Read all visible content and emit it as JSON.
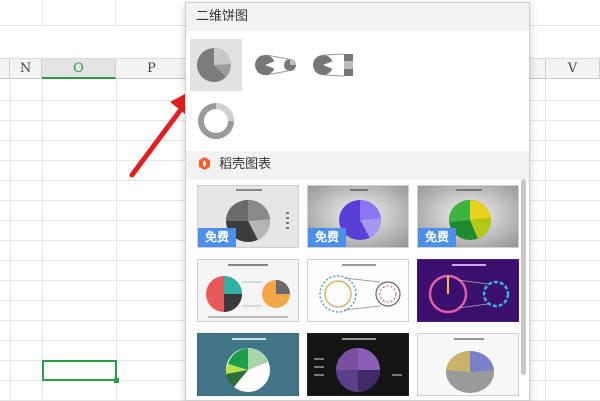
{
  "spreadsheet": {
    "columns": [
      {
        "label": "",
        "active": false
      },
      {
        "label": "N",
        "active": false
      },
      {
        "label": "O",
        "active": true
      },
      {
        "label": "P",
        "active": false
      },
      {
        "label": "V",
        "active": false
      }
    ]
  },
  "popup": {
    "section_2d_pie": "二维饼图",
    "section_wuke": "稻壳图表",
    "chart_types": [
      {
        "name": "pie",
        "selected": true
      },
      {
        "name": "pie-of-pie",
        "selected": false
      },
      {
        "name": "bar-of-pie",
        "selected": false
      },
      {
        "name": "doughnut",
        "selected": false
      }
    ],
    "free_label": "免费",
    "templates": [
      {
        "name": "gray-3d-pie",
        "free": true
      },
      {
        "name": "purple-3d-pie",
        "free": true
      },
      {
        "name": "green-yellow-3d-pie",
        "free": true
      },
      {
        "name": "multi-color-pie-of-pie",
        "free": false
      },
      {
        "name": "dashed-ring-pie-of-pie",
        "free": false
      },
      {
        "name": "purple-bg-pie-of-pie",
        "free": false
      },
      {
        "name": "teal-bg-pie",
        "free": false
      },
      {
        "name": "dark-bg-purple-pie",
        "free": false
      },
      {
        "name": "light-3d-pie",
        "free": false
      }
    ]
  },
  "colors": {
    "accent_green": "#2a9d45",
    "free_badge_blue": "#4b8fe8",
    "arrow_red": "#e02020",
    "wuke_logo_orange": "#f0612e"
  }
}
